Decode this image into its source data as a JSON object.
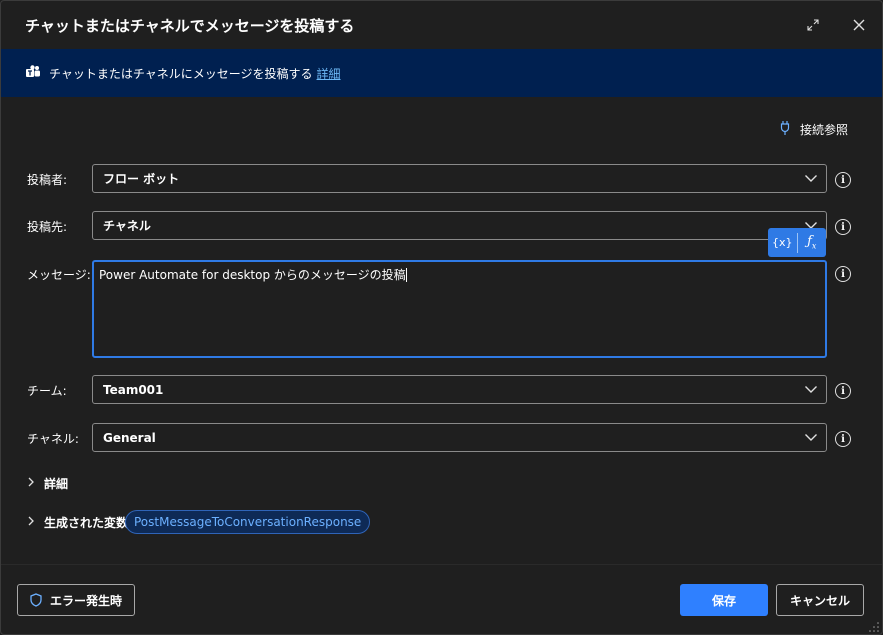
{
  "dialog": {
    "title": "チャットまたはチャネルでメッセージを投稿する"
  },
  "banner": {
    "text": "チャットまたはチャネルにメッセージを投稿する",
    "link": "詳細"
  },
  "connection_ref": "接続参照",
  "fields": {
    "poster": {
      "label": "投稿者:",
      "value": "フロー ボット"
    },
    "post_in": {
      "label": "投稿先:",
      "value": "チャネル"
    },
    "message": {
      "label": "メッセージ:",
      "value": "Power Automate for desktop からのメッセージの投稿"
    },
    "team": {
      "label": "チーム:",
      "value": "Team001"
    },
    "channel": {
      "label": "チャネル:",
      "value": "General"
    }
  },
  "var_buttons": {
    "variable": "{x}",
    "expression": "fx"
  },
  "details_label": "詳細",
  "generated_vars": {
    "label": "生成された変数",
    "variables": [
      "PostMessageToConversationResponse"
    ]
  },
  "footer": {
    "on_error": "エラー発生時",
    "save": "保存",
    "cancel": "キャンセル"
  },
  "colors": {
    "background": "#1f1f1f",
    "banner": "#002050",
    "accent": "#2f80ff",
    "link": "#6cb8f6"
  }
}
